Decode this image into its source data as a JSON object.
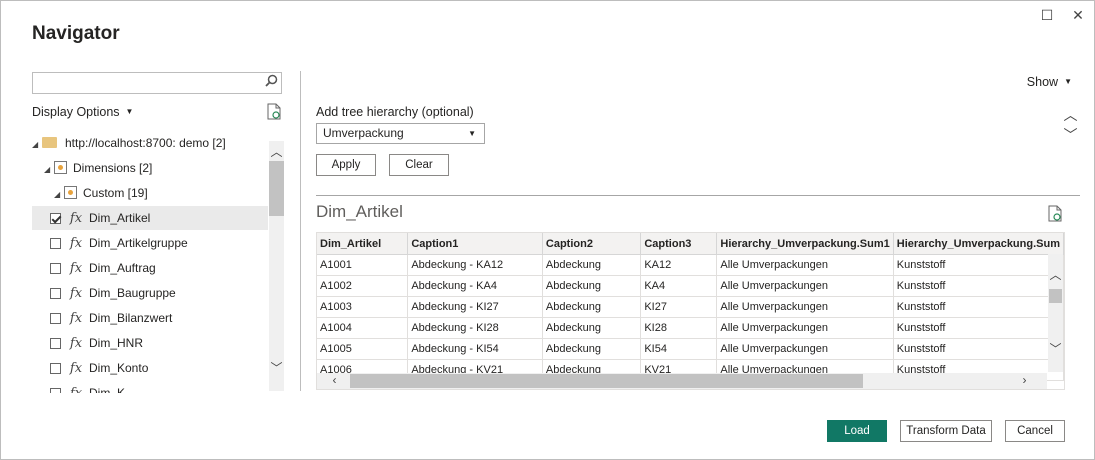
{
  "window": {
    "title": "Navigator",
    "maximize_glyph": "☐",
    "close_glyph": "✕"
  },
  "left": {
    "search_placeholder": "",
    "display_options": "Display Options",
    "tree": [
      {
        "label": "http://localhost:8700: demo [2]",
        "level": 0,
        "kind": "folder"
      },
      {
        "label": "Dimensions [2]",
        "level": 1,
        "kind": "cube"
      },
      {
        "label": "Custom [19]",
        "level": 2,
        "kind": "cube"
      },
      {
        "label": "Dim_Artikel",
        "level": 3,
        "kind": "fx",
        "checked": true,
        "selected": true
      },
      {
        "label": "Dim_Artikelgruppe",
        "level": 3,
        "kind": "fx",
        "checked": false
      },
      {
        "label": "Dim_Auftrag",
        "level": 3,
        "kind": "fx",
        "checked": false
      },
      {
        "label": "Dim_Baugruppe",
        "level": 3,
        "kind": "fx",
        "checked": false
      },
      {
        "label": "Dim_Bilanzwert",
        "level": 3,
        "kind": "fx",
        "checked": false
      },
      {
        "label": "Dim_HNR",
        "level": 3,
        "kind": "fx",
        "checked": false
      },
      {
        "label": "Dim_Konto",
        "level": 3,
        "kind": "fx",
        "checked": false
      },
      {
        "label": "Dim_K...",
        "level": 3,
        "kind": "fx",
        "checked": false
      }
    ]
  },
  "right": {
    "show_label": "Show",
    "tree_hierarchy_label": "Add tree hierarchy (optional)",
    "tree_hierarchy_value": "Umverpackung",
    "apply_label": "Apply",
    "clear_label": "Clear",
    "preview_title": "Dim_Artikel",
    "columns": [
      "Dim_Artikel",
      "Caption1",
      "Caption2",
      "Caption3",
      "Hierarchy_Umverpackung.Sum1",
      "Hierarchy_Umverpackung.Sum"
    ],
    "rows": [
      [
        "A1001",
        "Abdeckung - KA12",
        "Abdeckung",
        "KA12",
        "Alle Umverpackungen",
        "Kunststoff"
      ],
      [
        "A1002",
        "Abdeckung - KA4",
        "Abdeckung",
        "KA4",
        "Alle Umverpackungen",
        "Kunststoff"
      ],
      [
        "A1003",
        "Abdeckung - KI27",
        "Abdeckung",
        "KI27",
        "Alle Umverpackungen",
        "Kunststoff"
      ],
      [
        "A1004",
        "Abdeckung - KI28",
        "Abdeckung",
        "KI28",
        "Alle Umverpackungen",
        "Kunststoff"
      ],
      [
        "A1005",
        "Abdeckung - KI54",
        "Abdeckung",
        "KI54",
        "Alle Umverpackungen",
        "Kunststoff"
      ],
      [
        "A1006",
        "Abdeckung - KV21",
        "Abdeckung",
        "KV21",
        "Alle Umverpackungen",
        "Kunststoff"
      ]
    ]
  },
  "footer": {
    "load_label": "Load",
    "transform_label": "Transform Data",
    "cancel_label": "Cancel"
  },
  "colors": {
    "primary": "#117865"
  }
}
